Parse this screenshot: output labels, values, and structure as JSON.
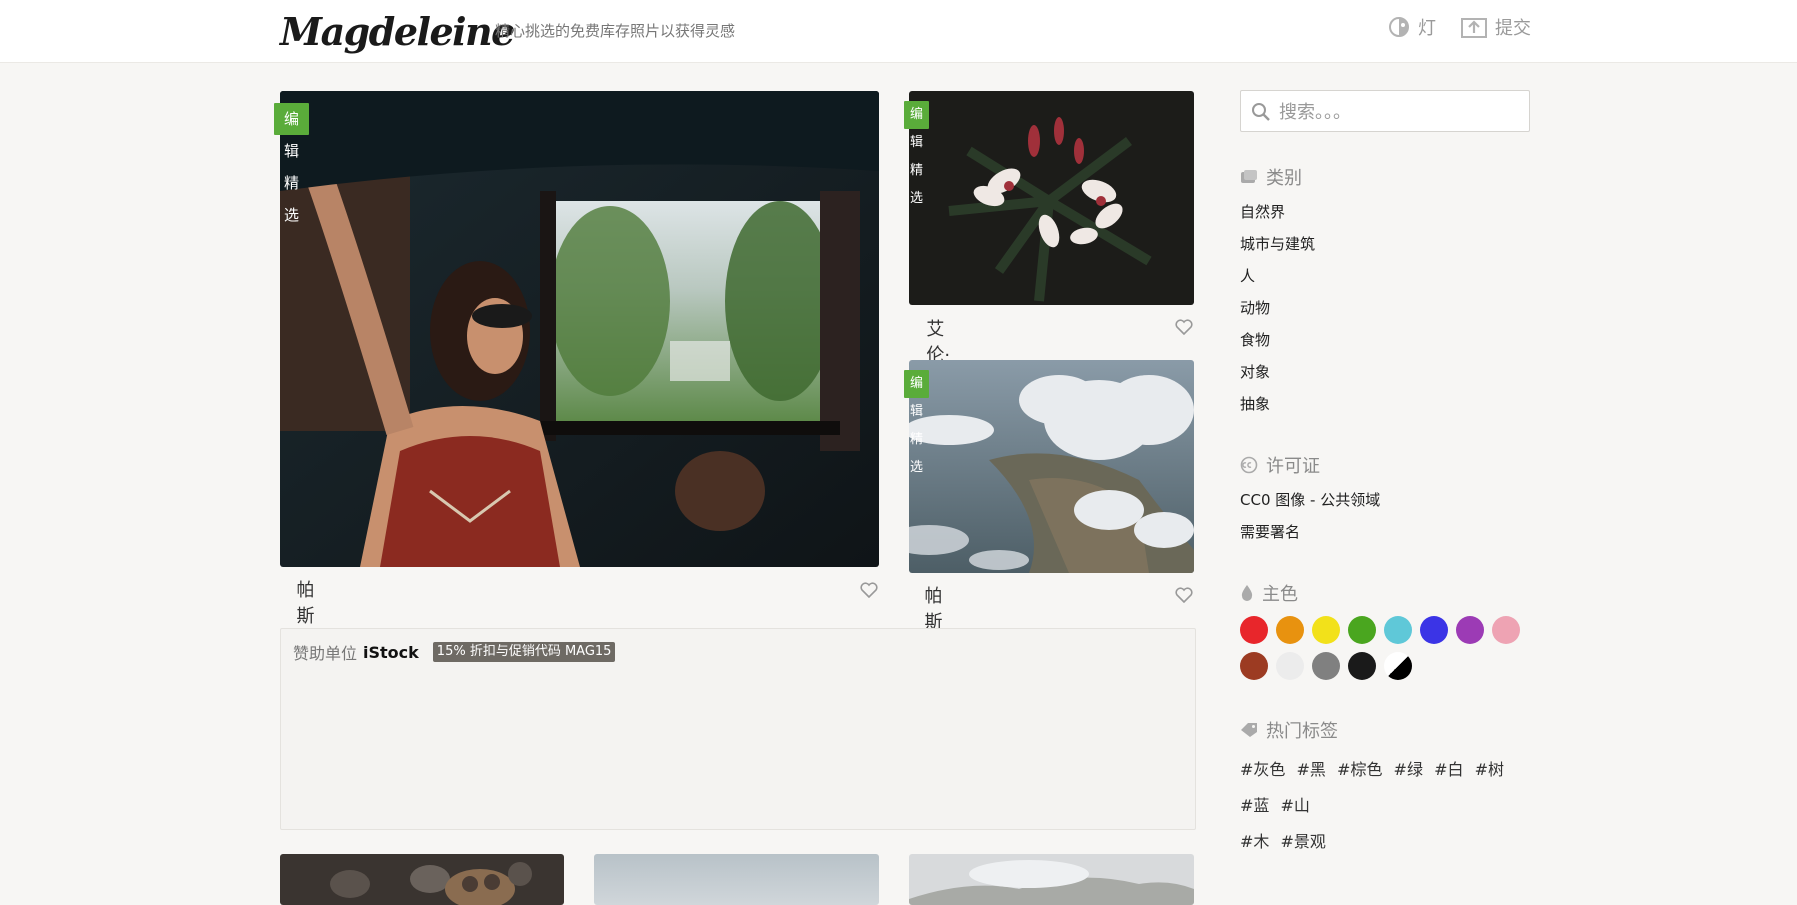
{
  "header": {
    "logo": "Magdeleine",
    "tagline": "精心挑选的免费库存照片以获得灵感",
    "theme_label": "灯",
    "submit_label": "提交"
  },
  "badge_label": "编辑精选",
  "photos": [
    {
      "author": "帕斯夸莱·维蒂洛"
    },
    {
      "author": "艾伦·卡贝洛"
    },
    {
      "author": "帕斯夸莱·维蒂洛"
    }
  ],
  "sponsor": {
    "label": "赞助单位",
    "brand": "iStock",
    "promo": "15% 折扣与促销代码 MAG15"
  },
  "sidebar": {
    "search_placeholder": "搜索。。。",
    "categories_title": "类别",
    "categories": [
      "自然界",
      "城市与建筑",
      "人",
      "动物",
      "食物",
      "对象",
      "抽象"
    ],
    "license_title": "许可证",
    "licenses": [
      "CC0 图像 - 公共领域",
      "需要署名"
    ],
    "colors_title": "主色",
    "colors": [
      "#e8262b",
      "#e8920f",
      "#f2e11a",
      "#4aa61f",
      "#5fc8d8",
      "#3b34e6",
      "#9c3bb5",
      "#eea3b3",
      "#9c3b22",
      "#ececec",
      "#808080",
      "#1a1a1a",
      "black-white"
    ],
    "tags_title": "热门标签",
    "tags": [
      "#灰色",
      "#黑",
      "#棕色",
      "#绿",
      "#白",
      "#树",
      "#蓝",
      "#山",
      "#木",
      "#景观"
    ]
  },
  "accent_color": "#5aac3a"
}
